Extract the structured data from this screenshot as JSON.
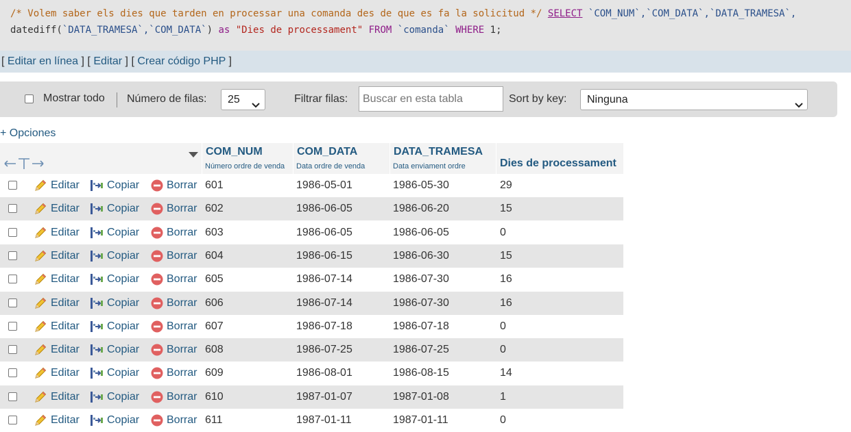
{
  "sql": {
    "line1_comment": "/* Volem saber els dies que tarden en processar una comanda des de que es fa la solicitud */",
    "select_kw": "SELECT",
    "line1_fields": "`COM_NUM`,`COM_DATA`,`DATA_TRAMESA`,",
    "line2_func": "datediff(",
    "line2_args": "`DATA_TRAMESA`,`COM_DATA`",
    "line2_close": ")",
    "as_kw": "as",
    "alias": "\"Dies de processament\"",
    "from_kw": "FROM",
    "table": "`comanda`",
    "where_kw": "WHERE",
    "where_val": "1;"
  },
  "links": {
    "edit_inline": "Editar en línea",
    "edit": "Editar",
    "create_php": "Crear código PHP"
  },
  "nav": {
    "show_all": "Mostrar todo",
    "rows_label": "Número de filas:",
    "rows_value": "25",
    "filter_label": "Filtrar filas:",
    "filter_placeholder": "Buscar en esta tabla",
    "sort_label": "Sort by key:",
    "sort_value": "Ninguna"
  },
  "options_link": "+ Opciones",
  "table": {
    "columns": [
      {
        "title": "COM_NUM",
        "comment": "Número ordre de venda"
      },
      {
        "title": "COM_DATA",
        "comment": "Data ordre de venda"
      },
      {
        "title": "DATA_TRAMESA",
        "comment": "Data enviament ordre"
      },
      {
        "title": "Dies de processament",
        "comment": ""
      }
    ],
    "actions": {
      "edit": "Editar",
      "copy": "Copiar",
      "delete": "Borrar"
    },
    "rows": [
      {
        "com_num": "601",
        "com_data": "1986-05-01",
        "data_tramesa": "1986-05-30",
        "dies": "29"
      },
      {
        "com_num": "602",
        "com_data": "1986-06-05",
        "data_tramesa": "1986-06-20",
        "dies": "15"
      },
      {
        "com_num": "603",
        "com_data": "1986-06-05",
        "data_tramesa": "1986-06-05",
        "dies": "0"
      },
      {
        "com_num": "604",
        "com_data": "1986-06-15",
        "data_tramesa": "1986-06-30",
        "dies": "15"
      },
      {
        "com_num": "605",
        "com_data": "1986-07-14",
        "data_tramesa": "1986-07-30",
        "dies": "16"
      },
      {
        "com_num": "606",
        "com_data": "1986-07-14",
        "data_tramesa": "1986-07-30",
        "dies": "16"
      },
      {
        "com_num": "607",
        "com_data": "1986-07-18",
        "data_tramesa": "1986-07-18",
        "dies": "0"
      },
      {
        "com_num": "608",
        "com_data": "1986-07-25",
        "data_tramesa": "1986-07-25",
        "dies": "0"
      },
      {
        "com_num": "609",
        "com_data": "1986-08-01",
        "data_tramesa": "1986-08-15",
        "dies": "14"
      },
      {
        "com_num": "610",
        "com_data": "1987-01-07",
        "data_tramesa": "1987-01-08",
        "dies": "1"
      },
      {
        "com_num": "611",
        "com_data": "1987-01-11",
        "data_tramesa": "1987-01-11",
        "dies": "0"
      }
    ]
  }
}
